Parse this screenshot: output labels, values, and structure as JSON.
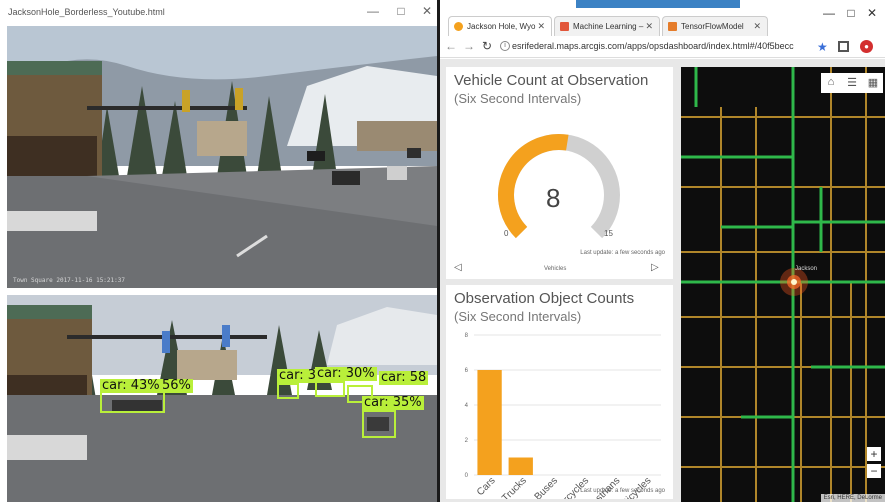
{
  "video_window": {
    "title": "JacksonHole_Borderless_Youtube.html",
    "controls": [
      "—",
      "□",
      "✕"
    ],
    "top_feed_timestamp": "Town Square 2017-11-16 15:21:37",
    "detections": [
      {
        "label": "car: 43%"
      },
      {
        "label": "56%"
      },
      {
        "label": "car: 30%"
      },
      {
        "label": "car: 30%"
      },
      {
        "label": "car: 58"
      },
      {
        "label": "car: 35%"
      }
    ]
  },
  "browser": {
    "tabs": [
      {
        "label": "Jackson Hole, Wyo",
        "icon": "arcgis-icon"
      },
      {
        "label": "Machine Learning –",
        "icon": "ml-icon"
      },
      {
        "label": "TensorFlowModel",
        "icon": "tf-icon"
      }
    ],
    "controls": [
      "—",
      "□",
      "✕"
    ],
    "url": "esrifederal.maps.arcgis.com/apps/opsdashboard/index.html#/40f5becc"
  },
  "dashboard": {
    "gauge": {
      "title": "Vehicle Count at Observation",
      "subtitle": "(Six Second Intervals)",
      "value": "8",
      "min_label": "0",
      "max_label": "15",
      "value_num": 8,
      "min_num": 0,
      "max_num": 15,
      "last_update": "Last update: a few seconds ago",
      "footer": "Vehicles",
      "arc_color": "#f4a11e",
      "track_color": "#d0d0d0"
    },
    "counts": {
      "title": "Observation Object Counts",
      "subtitle": "(Six Second Intervals)",
      "last_update": "Last update: a few seconds ago"
    },
    "map": {
      "tools": [
        "home-icon",
        "list-icon",
        "basemap-icon"
      ],
      "label": "Jackson",
      "zoom_in": "+",
      "zoom_out": "−",
      "attribution": "Esri, HERE, DeLorme"
    }
  },
  "chart_data": {
    "type": "bar",
    "title": "Observation Object Counts",
    "subtitle": "(Six Second Intervals)",
    "categories": [
      "Cars",
      "Large Trucks",
      "Buses",
      "Motorcycles",
      "Pedestrians",
      "Bicycles"
    ],
    "values": [
      6,
      1,
      0,
      0,
      0,
      0
    ],
    "ylim": [
      0,
      8
    ],
    "yticks": [
      0,
      2,
      4,
      6,
      8
    ],
    "bar_color": "#f4a11e",
    "grid": true
  }
}
